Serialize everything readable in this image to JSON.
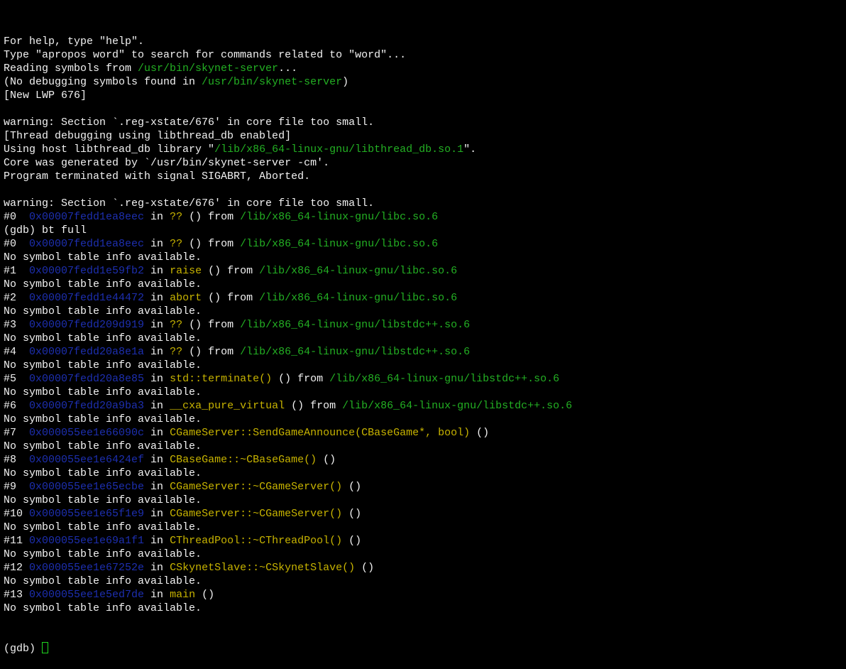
{
  "terminal": {
    "colors": {
      "background": "#000000",
      "text": "#f2f2f2",
      "path": "#23b023",
      "address": "#1d2fb0",
      "function": "#c8b400",
      "cursor": "#1fd71f"
    },
    "lines": [
      [
        {
          "t": "For help, type \"help\"."
        }
      ],
      [
        {
          "t": "Type \"apropos word\" to search for commands related to \"word\"..."
        }
      ],
      [
        {
          "t": "Reading symbols from "
        },
        {
          "t": "/usr/bin/skynet-server",
          "c": "path"
        },
        {
          "t": "..."
        }
      ],
      [
        {
          "t": "(No debugging symbols found in "
        },
        {
          "t": "/usr/bin/skynet-server",
          "c": "path"
        },
        {
          "t": ")"
        }
      ],
      [
        {
          "t": "[New LWP 676]"
        }
      ],
      [],
      [
        {
          "t": "warning: Section `.reg-xstate/676' in core file too small."
        }
      ],
      [
        {
          "t": "[Thread debugging using libthread_db enabled]"
        }
      ],
      [
        {
          "t": "Using host libthread_db library \""
        },
        {
          "t": "/lib/x86_64-linux-gnu/libthread_db.so.1",
          "c": "path"
        },
        {
          "t": "\"."
        }
      ],
      [
        {
          "t": "Core was generated by `/usr/bin/skynet-server -cm'."
        }
      ],
      [
        {
          "t": "Program terminated with signal SIGABRT, Aborted."
        }
      ],
      [],
      [
        {
          "t": "warning: Section `.reg-xstate/676' in core file too small."
        }
      ],
      [
        {
          "t": "#0  "
        },
        {
          "t": "0x00007fedd1ea8eec",
          "c": "addr"
        },
        {
          "t": " in "
        },
        {
          "t": "??",
          "c": "func"
        },
        {
          "t": " () from "
        },
        {
          "t": "/lib/x86_64-linux-gnu/libc.so.6",
          "c": "path"
        }
      ],
      [
        {
          "t": "(gdb) bt full"
        }
      ],
      [
        {
          "t": "#0  "
        },
        {
          "t": "0x00007fedd1ea8eec",
          "c": "addr"
        },
        {
          "t": " in "
        },
        {
          "t": "??",
          "c": "func"
        },
        {
          "t": " () from "
        },
        {
          "t": "/lib/x86_64-linux-gnu/libc.so.6",
          "c": "path"
        }
      ],
      [
        {
          "t": "No symbol table info available."
        }
      ],
      [
        {
          "t": "#1  "
        },
        {
          "t": "0x00007fedd1e59fb2",
          "c": "addr"
        },
        {
          "t": " in "
        },
        {
          "t": "raise",
          "c": "func"
        },
        {
          "t": " () from "
        },
        {
          "t": "/lib/x86_64-linux-gnu/libc.so.6",
          "c": "path"
        }
      ],
      [
        {
          "t": "No symbol table info available."
        }
      ],
      [
        {
          "t": "#2  "
        },
        {
          "t": "0x00007fedd1e44472",
          "c": "addr"
        },
        {
          "t": " in "
        },
        {
          "t": "abort",
          "c": "func"
        },
        {
          "t": " () from "
        },
        {
          "t": "/lib/x86_64-linux-gnu/libc.so.6",
          "c": "path"
        }
      ],
      [
        {
          "t": "No symbol table info available."
        }
      ],
      [
        {
          "t": "#3  "
        },
        {
          "t": "0x00007fedd209d919",
          "c": "addr"
        },
        {
          "t": " in "
        },
        {
          "t": "??",
          "c": "func"
        },
        {
          "t": " () from "
        },
        {
          "t": "/lib/x86_64-linux-gnu/libstdc++.so.6",
          "c": "path"
        }
      ],
      [
        {
          "t": "No symbol table info available."
        }
      ],
      [
        {
          "t": "#4  "
        },
        {
          "t": "0x00007fedd20a8e1a",
          "c": "addr"
        },
        {
          "t": " in "
        },
        {
          "t": "??",
          "c": "func"
        },
        {
          "t": " () from "
        },
        {
          "t": "/lib/x86_64-linux-gnu/libstdc++.so.6",
          "c": "path"
        }
      ],
      [
        {
          "t": "No symbol table info available."
        }
      ],
      [
        {
          "t": "#5  "
        },
        {
          "t": "0x00007fedd20a8e85",
          "c": "addr"
        },
        {
          "t": " in "
        },
        {
          "t": "std::terminate()",
          "c": "func"
        },
        {
          "t": " () from "
        },
        {
          "t": "/lib/x86_64-linux-gnu/libstdc++.so.6",
          "c": "path"
        }
      ],
      [
        {
          "t": "No symbol table info available."
        }
      ],
      [
        {
          "t": "#6  "
        },
        {
          "t": "0x00007fedd20a9ba3",
          "c": "addr"
        },
        {
          "t": " in "
        },
        {
          "t": "__cxa_pure_virtual",
          "c": "func"
        },
        {
          "t": " () from "
        },
        {
          "t": "/lib/x86_64-linux-gnu/libstdc++.so.6",
          "c": "path"
        }
      ],
      [
        {
          "t": "No symbol table info available."
        }
      ],
      [
        {
          "t": "#7  "
        },
        {
          "t": "0x000055ee1e66090c",
          "c": "addr"
        },
        {
          "t": " in "
        },
        {
          "t": "CGameServer::SendGameAnnounce(CBaseGame*, bool)",
          "c": "func"
        },
        {
          "t": " ()"
        }
      ],
      [
        {
          "t": "No symbol table info available."
        }
      ],
      [
        {
          "t": "#8  "
        },
        {
          "t": "0x000055ee1e6424ef",
          "c": "addr"
        },
        {
          "t": " in "
        },
        {
          "t": "CBaseGame::~CBaseGame()",
          "c": "func"
        },
        {
          "t": " ()"
        }
      ],
      [
        {
          "t": "No symbol table info available."
        }
      ],
      [
        {
          "t": "#9  "
        },
        {
          "t": "0x000055ee1e65ecbe",
          "c": "addr"
        },
        {
          "t": " in "
        },
        {
          "t": "CGameServer::~CGameServer()",
          "c": "func"
        },
        {
          "t": " ()"
        }
      ],
      [
        {
          "t": "No symbol table info available."
        }
      ],
      [
        {
          "t": "#10 "
        },
        {
          "t": "0x000055ee1e65f1e9",
          "c": "addr"
        },
        {
          "t": " in "
        },
        {
          "t": "CGameServer::~CGameServer()",
          "c": "func"
        },
        {
          "t": " ()"
        }
      ],
      [
        {
          "t": "No symbol table info available."
        }
      ],
      [
        {
          "t": "#11 "
        },
        {
          "t": "0x000055ee1e69a1f1",
          "c": "addr"
        },
        {
          "t": " in "
        },
        {
          "t": "CThreadPool::~CThreadPool()",
          "c": "func"
        },
        {
          "t": " ()"
        }
      ],
      [
        {
          "t": "No symbol table info available."
        }
      ],
      [
        {
          "t": "#12 "
        },
        {
          "t": "0x000055ee1e67252e",
          "c": "addr"
        },
        {
          "t": " in "
        },
        {
          "t": "CSkynetSlave::~CSkynetSlave()",
          "c": "func"
        },
        {
          "t": " ()"
        }
      ],
      [
        {
          "t": "No symbol table info available."
        }
      ],
      [
        {
          "t": "#13 "
        },
        {
          "t": "0x000055ee1e5ed7de",
          "c": "addr"
        },
        {
          "t": " in "
        },
        {
          "t": "main",
          "c": "func"
        },
        {
          "t": " ()"
        }
      ],
      [
        {
          "t": "No symbol table info available."
        }
      ]
    ],
    "prompt": "(gdb) ",
    "input_value": ""
  }
}
